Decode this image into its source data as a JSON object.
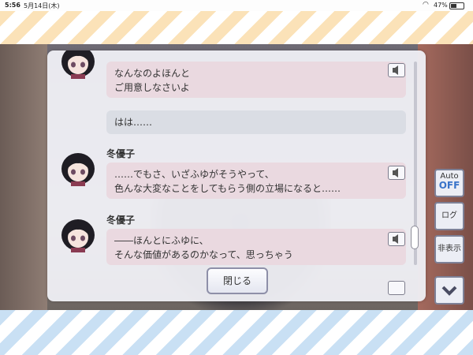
{
  "status_bar": {
    "time": "5:56",
    "date": "5月14日(木)",
    "battery": "47%"
  },
  "log": {
    "messages": [
      {
        "speaker": "",
        "line1": "なんなのよほんと",
        "line2": "ご用意しなさいよ",
        "has_avatar": true,
        "has_voice": true
      },
      {
        "speaker": "",
        "line1": "はは……",
        "line2": "",
        "has_avatar": false,
        "has_voice": false
      },
      {
        "speaker": "冬優子",
        "line1": "……でもさ、いざふゆがそうやって、",
        "line2": "色んな大変なことをしてもらう側の立場になると……",
        "has_avatar": true,
        "has_voice": true
      },
      {
        "speaker": "冬優子",
        "line1": "――ほんとにふゆに、",
        "line2": "そんな価値があるのかなって、思っちゃう",
        "has_avatar": true,
        "has_voice": true
      }
    ],
    "close_label": "閉じる"
  },
  "side_menu": {
    "auto_label": "Auto",
    "auto_state": "OFF",
    "log_label": "ログ",
    "hide_label": "非表示"
  },
  "colors": {
    "bubble_voiced": "#ead9e0",
    "bubble_plain": "#dadde4",
    "accent_blue": "#3a74c9"
  }
}
